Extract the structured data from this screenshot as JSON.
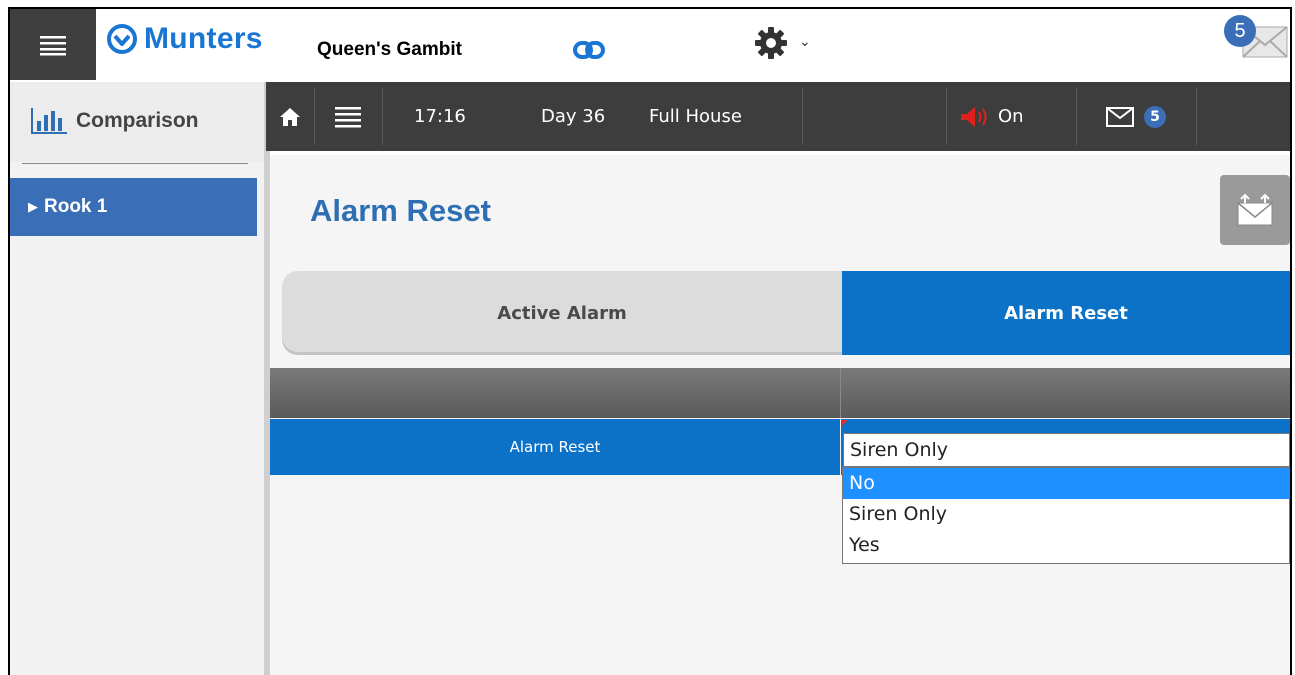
{
  "header": {
    "brand": "Munters",
    "farm_name": "Queen's Gambit",
    "mail_count": "5"
  },
  "sidebar": {
    "title": "Comparison",
    "items": [
      {
        "label": "Rook 1"
      }
    ]
  },
  "statusbar": {
    "time": "17:16",
    "day": "Day 36",
    "house": "Full House",
    "alarm_state": "On",
    "mail_count": "5"
  },
  "main": {
    "title": "Alarm Reset",
    "tabs": [
      {
        "label": "Active Alarm",
        "active": false
      },
      {
        "label": "Alarm Reset",
        "active": true
      }
    ],
    "row_label": "Alarm Reset",
    "select_value": "Siren Only",
    "options": [
      "No",
      "Siren Only",
      "Yes"
    ],
    "highlighted_option": "No"
  },
  "colors": {
    "brand_blue": "#1976d2",
    "tab_active": "#0b72c7",
    "sidebar_active": "#3a6fb8",
    "status_bar": "#3d3d3d"
  }
}
